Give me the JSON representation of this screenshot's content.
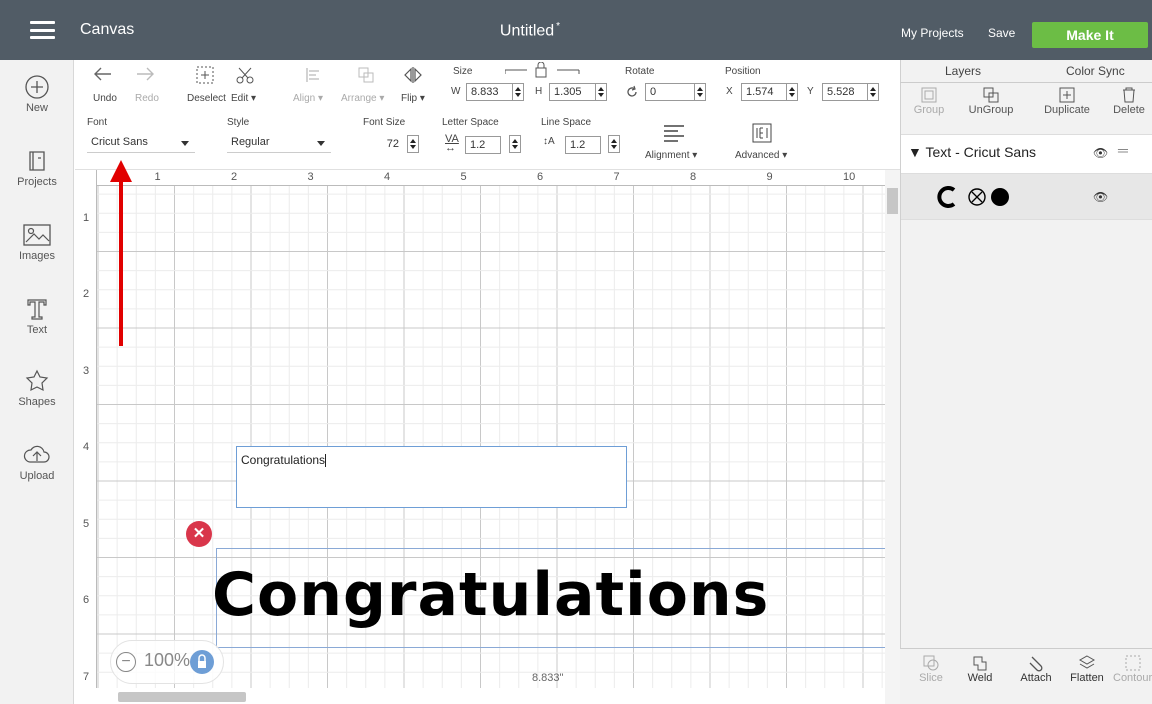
{
  "header": {
    "app_title": "Canvas",
    "doc_title": "Untitled",
    "doc_modified_mark": "*",
    "my_projects": "My Projects",
    "save": "Save",
    "make_it": "Make It"
  },
  "left_toolbar": {
    "items": [
      {
        "label": "New",
        "icon": "plus-circle-icon"
      },
      {
        "label": "Projects",
        "icon": "book-icon"
      },
      {
        "label": "Images",
        "icon": "image-icon"
      },
      {
        "label": "Text",
        "icon": "text-t-icon"
      },
      {
        "label": "Shapes",
        "icon": "shapes-icon"
      },
      {
        "label": "Upload",
        "icon": "cloud-upload-icon"
      }
    ]
  },
  "edit_toolbar": {
    "undo": "Undo",
    "redo": "Redo",
    "deselect": "Deselect",
    "edit": "Edit",
    "align": "Align",
    "arrange": "Arrange",
    "flip": "Flip",
    "size_label": "Size",
    "w_label": "W",
    "w_value": "8.833",
    "h_label": "H",
    "h_value": "1.305",
    "rotate_label": "Rotate",
    "rotate_value": "0",
    "position_label": "Position",
    "x_label": "X",
    "x_value": "1.574",
    "y_label": "Y",
    "y_value": "5.528",
    "font_label": "Font",
    "font_value": "Cricut Sans",
    "style_label": "Style",
    "style_value": "Regular",
    "font_size_label": "Font Size",
    "font_size_value": "72",
    "letter_space_label": "Letter Space",
    "letter_space_value": "1.2",
    "line_space_label": "Line Space",
    "line_space_value": "1.2",
    "alignment": "Alignment",
    "advanced": "Advanced"
  },
  "canvas": {
    "ruler_top": [
      "1",
      "2",
      "3",
      "4",
      "5",
      "6",
      "7",
      "8",
      "9",
      "10"
    ],
    "ruler_left": [
      "1",
      "2",
      "3",
      "4",
      "5",
      "6",
      "7"
    ],
    "text_input_value": "Congratulations",
    "rendered_text": "Congratulations",
    "width_readout": "8.833\"",
    "zoom": "100%",
    "delete_icon": "close-icon"
  },
  "right_panel": {
    "tabs": [
      "Layers",
      "Color Sync"
    ],
    "tools": [
      {
        "label": "Group",
        "enabled": false
      },
      {
        "label": "UnGroup",
        "enabled": true
      },
      {
        "label": "Duplicate",
        "enabled": true
      },
      {
        "label": "Delete",
        "enabled": true
      }
    ],
    "layer_group": "Text - Cricut Sans",
    "bottom_tools": [
      {
        "label": "Slice",
        "enabled": false
      },
      {
        "label": "Weld",
        "enabled": true
      },
      {
        "label": "Attach",
        "enabled": true
      },
      {
        "label": "Flatten",
        "enabled": true
      },
      {
        "label": "Contour",
        "enabled": false
      }
    ]
  },
  "colors": {
    "topbar": "#515c66",
    "make_it": "#6cbd45",
    "delete_red": "#d9364b",
    "annotation_arrow": "#e10000",
    "selection_blue": "#6e9ed6"
  }
}
